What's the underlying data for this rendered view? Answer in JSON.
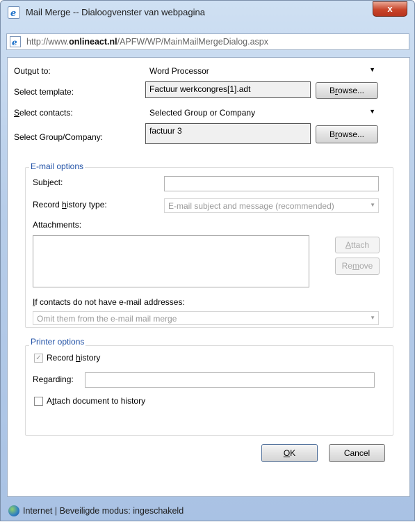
{
  "window": {
    "title": "Mail Merge -- Dialoogvenster van webpagina",
    "close_label": "x",
    "url_prefix": "http://www.",
    "url_domain": "onlineact.nl",
    "url_path": "/APFW/WP/MainMailMergeDialog.aspx"
  },
  "form": {
    "output_to": {
      "label_pre": "Out",
      "label_key": "p",
      "label_post": "ut to:",
      "value": "Word Processor"
    },
    "template": {
      "label": "Select template:",
      "value": "Factuur werkcongres[1].adt",
      "browse_pre": "B",
      "browse_key": "r",
      "browse_post": "owse..."
    },
    "contacts": {
      "label_pre": "",
      "label_key": "S",
      "label_post": "elect contacts:",
      "value": "Selected Group or Company"
    },
    "group": {
      "label": "Select Group/Company:",
      "value": "factuur 3",
      "browse_pre": "B",
      "browse_key": "r",
      "browse_post": "owse..."
    }
  },
  "email_options": {
    "legend": "E-mail options",
    "subject_label": "Subject:",
    "subject_value": "",
    "history_label_pre": "Record ",
    "history_label_key": "h",
    "history_label_post": "istory type:",
    "history_value": "E-mail subject and message (recommended)",
    "attachments_label": "Attachments:",
    "attach_pre": "",
    "attach_key": "A",
    "attach_post": "ttach",
    "remove_pre": "Re",
    "remove_key": "m",
    "remove_post": "ove",
    "no_email_label_pre": "",
    "no_email_label_key": "I",
    "no_email_label_post": "f contacts do not have e-mail addresses:",
    "no_email_value": "Omit them from the e-mail mail merge"
  },
  "printer_options": {
    "legend": "Printer options",
    "record_history_pre": "Record ",
    "record_history_key": "h",
    "record_history_post": "istory",
    "record_history_checked": true,
    "regarding_label_pre": "Re",
    "regarding_label_key": "g",
    "regarding_label_post": "arding:",
    "regarding_value": "",
    "attach_doc_pre": "A",
    "attach_doc_key": "t",
    "attach_doc_post": "tach document to history",
    "attach_doc_checked": false
  },
  "buttons": {
    "ok_key": "O",
    "ok_post": "K",
    "cancel": "Cancel"
  },
  "status": {
    "text": "Internet | Beveiligde modus: ingeschakeld"
  },
  "icons": {
    "title": "ie-icon",
    "address": "ie-page-icon",
    "status": "globe-icon"
  },
  "colors": {
    "legend": "#2353a7",
    "close_button": "#c8452a",
    "frame": "#b7cde9"
  }
}
